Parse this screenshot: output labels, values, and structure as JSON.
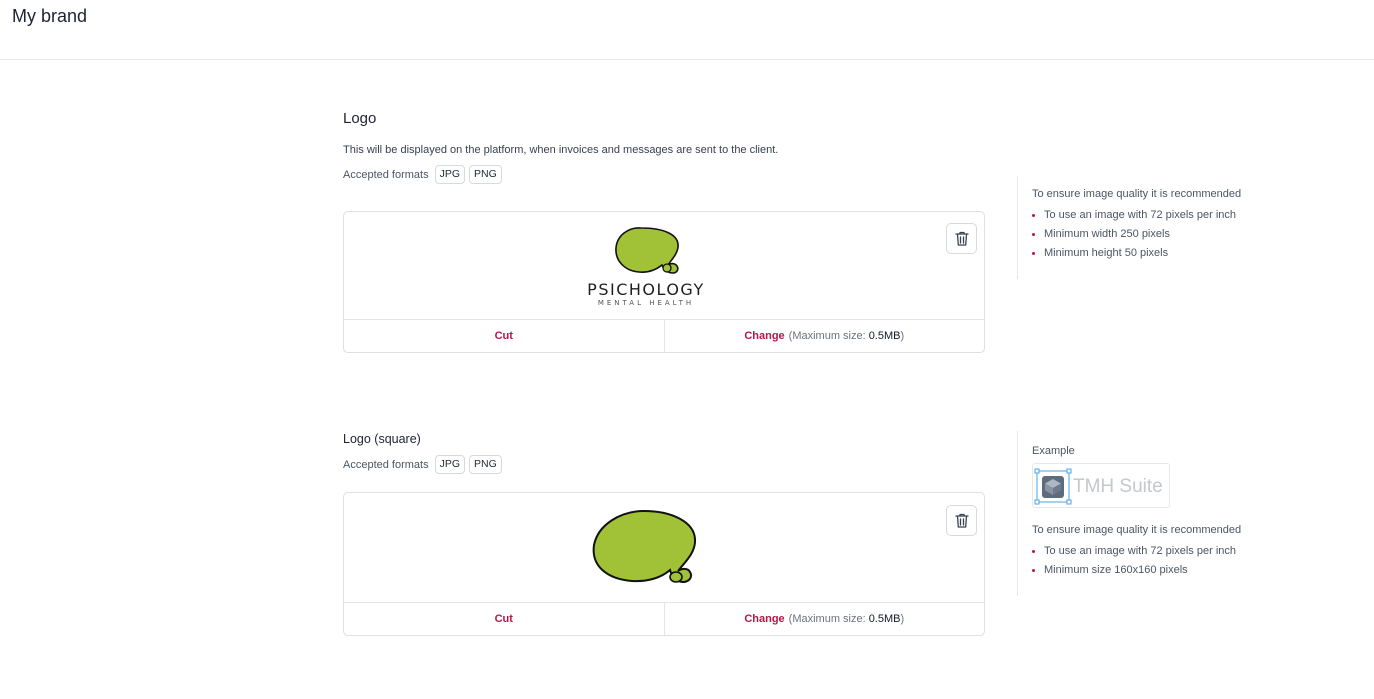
{
  "header": {
    "title": "My brand"
  },
  "logo_section": {
    "title": "Logo",
    "description": "This will be displayed on the platform, when invoices and messages are sent to the client.",
    "formats_label": "Accepted formats",
    "formats": [
      "JPG",
      "PNG"
    ],
    "preview": {
      "brand_name": "PSICHOLOGY",
      "brand_tagline": "MENTAL HEALTH"
    },
    "cut_label": "Cut",
    "change_label": "Change",
    "max_size_prefix": "(Maximum size:",
    "max_size_value": "0.5MB",
    "max_size_suffix": ")"
  },
  "logo_side": {
    "recommendation": "To ensure image quality it is recommended",
    "items": [
      "To use an image with 72 pixels per inch",
      "Minimum width 250 pixels",
      "Minimum height 50 pixels"
    ]
  },
  "square_section": {
    "title": "Logo (square)",
    "formats_label": "Accepted formats",
    "formats": [
      "JPG",
      "PNG"
    ],
    "cut_label": "Cut",
    "change_label": "Change",
    "max_size_prefix": "(Maximum size:",
    "max_size_value": "0.5MB",
    "max_size_suffix": ")"
  },
  "square_side": {
    "example_label": "Example",
    "example_brand": "TMH Suite",
    "recommendation": "To ensure image quality it is recommended",
    "items": [
      "To use an image with 72 pixels per inch",
      "Minimum size 160x160 pixels"
    ]
  },
  "colors": {
    "accent": "#b5174a",
    "logo_green": "#a1c236",
    "border": "#dcdfe3"
  },
  "icons": {
    "trash": "trash-icon",
    "logo": "speech-bubble-logo",
    "example": "cube-icon"
  }
}
